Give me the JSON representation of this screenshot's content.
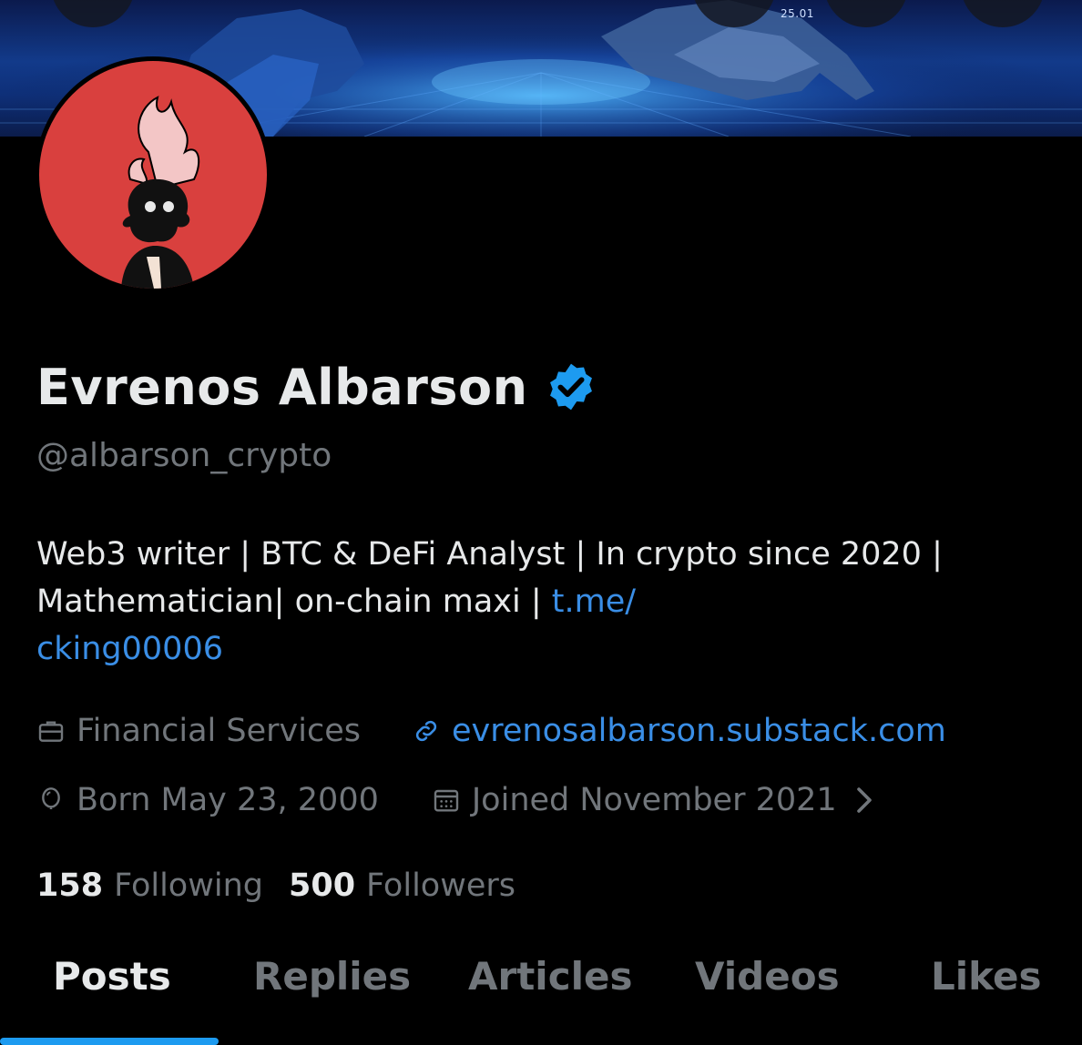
{
  "banner": {
    "date_label": "25.01"
  },
  "profile": {
    "display_name": "Evrenos Albarson",
    "handle": "@albarson_crypto",
    "bio_text": "Web3 writer | BTC & DeFi Analyst | In crypto since 2020 | Mathematician| on-chain maxi | ",
    "bio_link_line1": "t.me/",
    "bio_link_line2": "cking00006",
    "category": "Financial Services",
    "website": "evrenosalbarson.substack.com",
    "birthday": "Born May 23, 2000",
    "joined": "Joined November 2021",
    "following_count": "158",
    "following_label": "Following",
    "followers_count": "500",
    "followers_label": "Followers"
  },
  "tabs": [
    {
      "label": "Posts",
      "active": true
    },
    {
      "label": "Replies",
      "active": false
    },
    {
      "label": "Articles",
      "active": false
    },
    {
      "label": "Videos",
      "active": false
    },
    {
      "label": "Likes",
      "active": false
    }
  ],
  "colors": {
    "background": "#000000",
    "primary_text": "#e7e9ea",
    "secondary_text": "#71767b",
    "link": "#3a8ee6",
    "verified": "#1d9bf0",
    "avatar_bg": "#d9403e"
  },
  "icons": {
    "verified": "verified-badge-icon",
    "category": "briefcase-icon",
    "website": "link-icon",
    "birthday": "balloon-icon",
    "joined": "calendar-icon",
    "chevron": "chevron-right-icon"
  }
}
